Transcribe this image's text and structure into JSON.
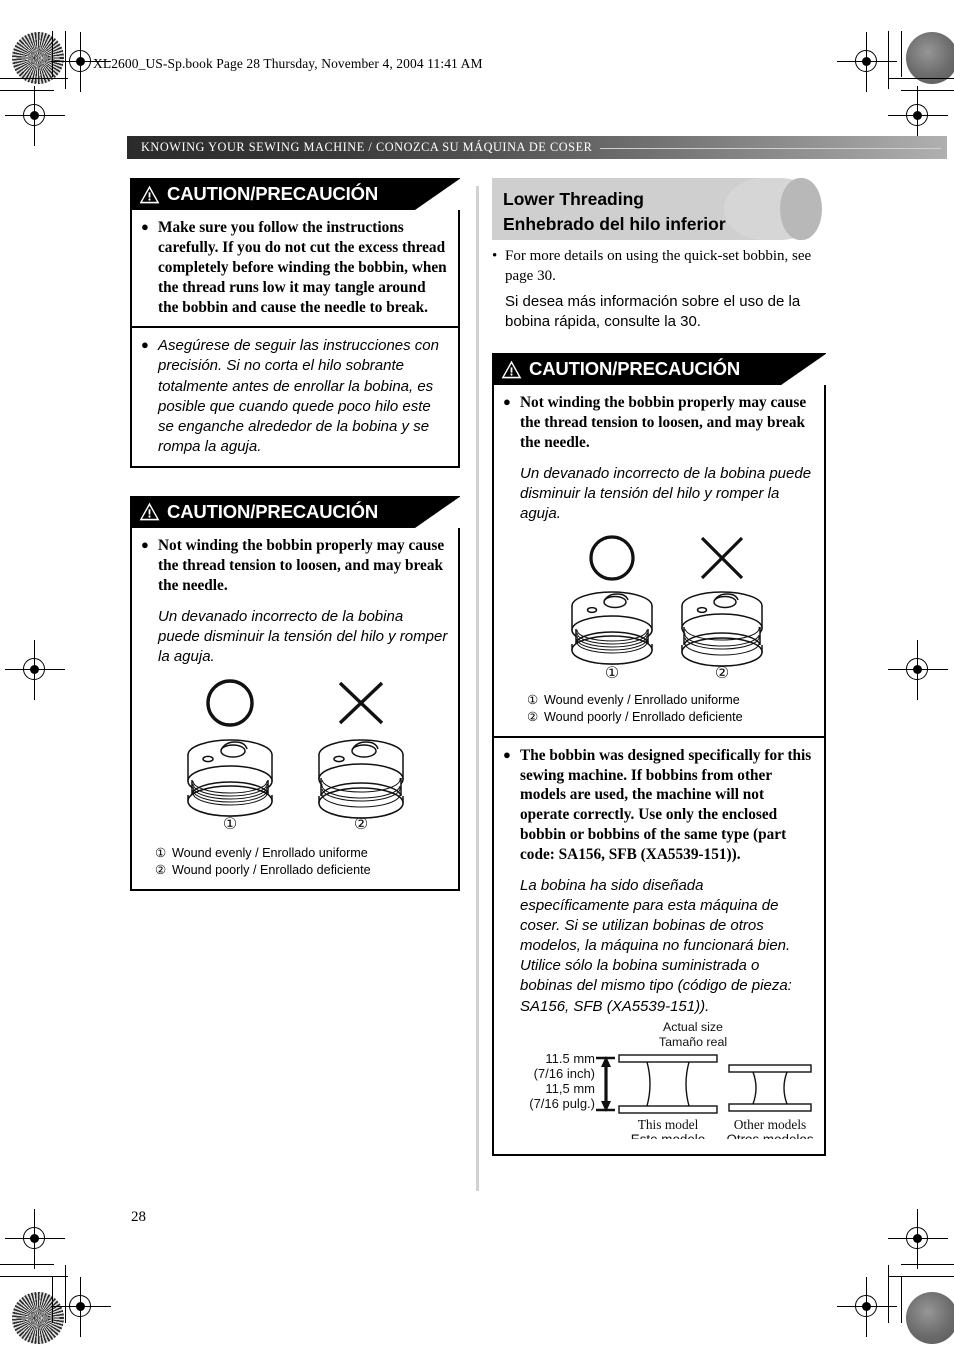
{
  "document": {
    "slug": "XL2600_US-Sp.book  Page 28  Thursday, November 4, 2004  11:41 AM",
    "section_header": "KNOWING YOUR SEWING MACHINE / CONOZCA SU MÁQUINA DE COSER",
    "page_number": "28"
  },
  "left_column": {
    "caution1": {
      "banner_label": "CAUTION/PRECAUCIÓN",
      "bullet_en": "Make sure you follow the instructions carefully. If you do not cut the excess thread completely before winding the bobbin, when the thread runs low it may tangle around the bobbin and cause the needle to break.",
      "bullet_es": "Asegúrese de seguir las instrucciones con precisión. Si no corta el hilo sobrante totalmente antes de enrollar la bobina, es posible que cuando quede poco hilo este se enganche alrededor de la bobina y se rompa la aguja.",
      "bullet_glyph": "●"
    },
    "caution2": {
      "banner_label": "CAUTION/PRECAUCIÓN",
      "bullet_en": "Not winding the bobbin properly may cause the thread tension to loosen, and may break the needle.",
      "bullet_es": "Un devanado incorrecto de la bobina puede disminuir la tensión del hilo y romper la aguja.",
      "bullet_glyph": "●",
      "figure": {
        "callout_1": "①",
        "callout_2": "②",
        "legend_1_num": "①",
        "legend_1_text": "Wound evenly / Enrollado uniforme",
        "legend_2_num": "②",
        "legend_2_text": "Wound poorly / Enrollado deficiente",
        "good_mark": "circle-mark",
        "bad_mark": "cross-mark"
      }
    }
  },
  "right_column": {
    "title_en": "Lower Threading",
    "title_es": "Enhebrado del hilo inferior",
    "note": {
      "bullet_glyph": "•",
      "en": "For more details on using the quick-set bobbin, see page 30.",
      "es": "Si desea más información sobre el uso de la bobina rápida, consulte la 30."
    },
    "caution": {
      "banner_label": "CAUTION/PRECAUCIÓN",
      "bullet_glyph": "●",
      "bullet1_en": "Not winding the bobbin properly may cause the thread tension to loosen, and may break the needle.",
      "bullet1_es": "Un devanado incorrecto de la bobina puede disminuir la tensión del hilo y romper la aguja.",
      "figure": {
        "callout_1": "①",
        "callout_2": "②",
        "legend_1_num": "①",
        "legend_1_text": "Wound evenly / Enrollado uniforme",
        "legend_2_num": "②",
        "legend_2_text": "Wound poorly / Enrollado deficiente"
      },
      "bullet2_en": "The bobbin was designed specifically for this sewing machine. If bobbins from other models are used, the machine will not operate correctly. Use only the enclosed bobbin or bobbins of the same type (part code: SA156, SFB (XA5539-151)).",
      "bullet2_es": "La bobina ha sido diseñada específicamente para esta máquina de coser. Si se utilizan bobinas de otros modelos, la máquina no funcionará bien. Utilice sólo la bobina suministrada o bobinas del mismo tipo (código de pieza: SA156, SFB (XA5539-151)).",
      "size_figure": {
        "title_en": "Actual size",
        "title_es": "Tamaño real",
        "dim_line1": "11.5 mm",
        "dim_line2": "(7/16 inch)",
        "dim_line3": "11,5 mm",
        "dim_line4": "(7/16 pulg.)",
        "left_label_en": "This model",
        "left_label_es": "Este modelo",
        "right_label_en": "Other models",
        "right_label_es": "Otros modelos"
      }
    }
  }
}
